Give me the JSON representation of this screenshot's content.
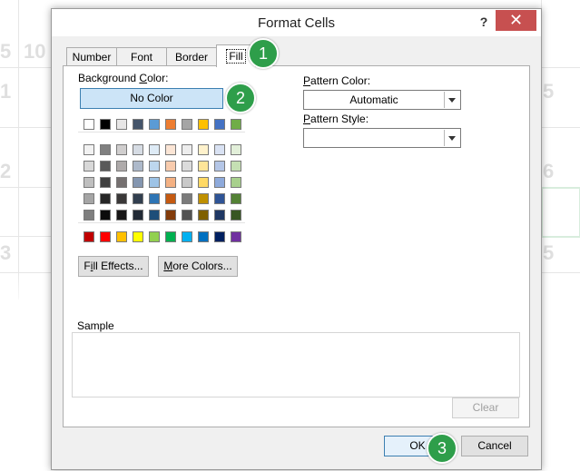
{
  "background_sheet": {
    "cells": [
      "5",
      "10",
      "1",
      "5",
      "2",
      "6",
      "3",
      "5"
    ]
  },
  "dialog": {
    "title": "Format Cells",
    "help_label": "?",
    "close_label": "✕"
  },
  "tabs": [
    {
      "label": "Number"
    },
    {
      "label": "Font"
    },
    {
      "label": "Border"
    },
    {
      "label": "Fill"
    }
  ],
  "fill": {
    "background_color_label": "Background Color:",
    "no_color_label": "No Color",
    "theme_top_row": [
      "#ffffff",
      "#000000",
      "#e7e6e6",
      "#44546a",
      "#5b9bd5",
      "#ed7d31",
      "#a5a5a5",
      "#ffc000",
      "#4472c4",
      "#70ad47"
    ],
    "theme_shades": [
      [
        "#f2f2f2",
        "#808080",
        "#d0cece",
        "#d6dce4",
        "#deebf6",
        "#fbe5d5",
        "#ededed",
        "#fff2cc",
        "#d9e2f3",
        "#e2efd9"
      ],
      [
        "#d8d8d8",
        "#595959",
        "#aeaaaa",
        "#adb9ca",
        "#bdd7ee",
        "#f8cbad",
        "#dbdbdb",
        "#fee599",
        "#b4c6e7",
        "#c5e0b3"
      ],
      [
        "#bfbfbf",
        "#3f3f3f",
        "#757070",
        "#8496b0",
        "#9dc3e6",
        "#f4b183",
        "#c9c9c9",
        "#ffd965",
        "#8eaadb",
        "#a8d08d"
      ],
      [
        "#a5a5a5",
        "#262626",
        "#3a3838",
        "#323f4f",
        "#2e75b5",
        "#c55a11",
        "#7b7b7b",
        "#bf9000",
        "#2f5496",
        "#538135"
      ],
      [
        "#7f7f7f",
        "#0c0c0c",
        "#171616",
        "#222a35",
        "#1e4e79",
        "#833c0b",
        "#525252",
        "#7f6000",
        "#1f3864",
        "#375623"
      ]
    ],
    "standard_colors": [
      "#c00000",
      "#ff0000",
      "#ffc000",
      "#ffff00",
      "#92d050",
      "#00b050",
      "#00b0f0",
      "#0070c0",
      "#002060",
      "#7030a0"
    ],
    "fill_effects_label": "Fill Effects...",
    "more_colors_label": "More Colors...",
    "pattern_color_label": "Pattern Color:",
    "pattern_color_value": "Automatic",
    "pattern_style_label": "Pattern Style:",
    "pattern_style_value": "",
    "sample_label": "Sample",
    "clear_label": "Clear"
  },
  "footer": {
    "ok_label": "OK",
    "cancel_label": "Cancel"
  },
  "callouts": [
    "1",
    "2",
    "3"
  ]
}
